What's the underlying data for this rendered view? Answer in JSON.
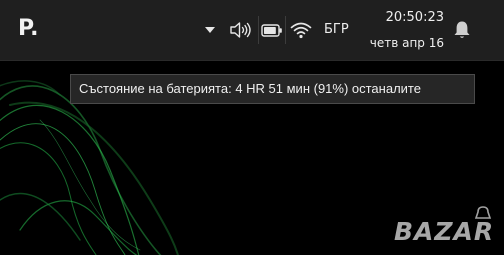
{
  "taskbar": {
    "app_logo": "P.",
    "tray": {
      "overflow_icon": "triangle-down-icon",
      "volume_icon": "speaker-volume-icon",
      "battery_icon": "battery-icon",
      "wifi_icon": "wifi-icon",
      "language": "БГР",
      "notifications_icon": "bell-icon"
    },
    "clock": {
      "time": "20:50:23",
      "date": "четв апр 16"
    }
  },
  "tooltip": {
    "text": "Състояние на батерията: 4 HR 51 мин (91%) останалите"
  },
  "battery": {
    "percent": 91
  },
  "watermark": {
    "text": "BAZAR"
  },
  "colors": {
    "taskbar_bg": "#1f1f1f",
    "tooltip_bg": "#262626",
    "wallpaper_accent": "#2fd65a",
    "text": "#f0f0f0"
  }
}
